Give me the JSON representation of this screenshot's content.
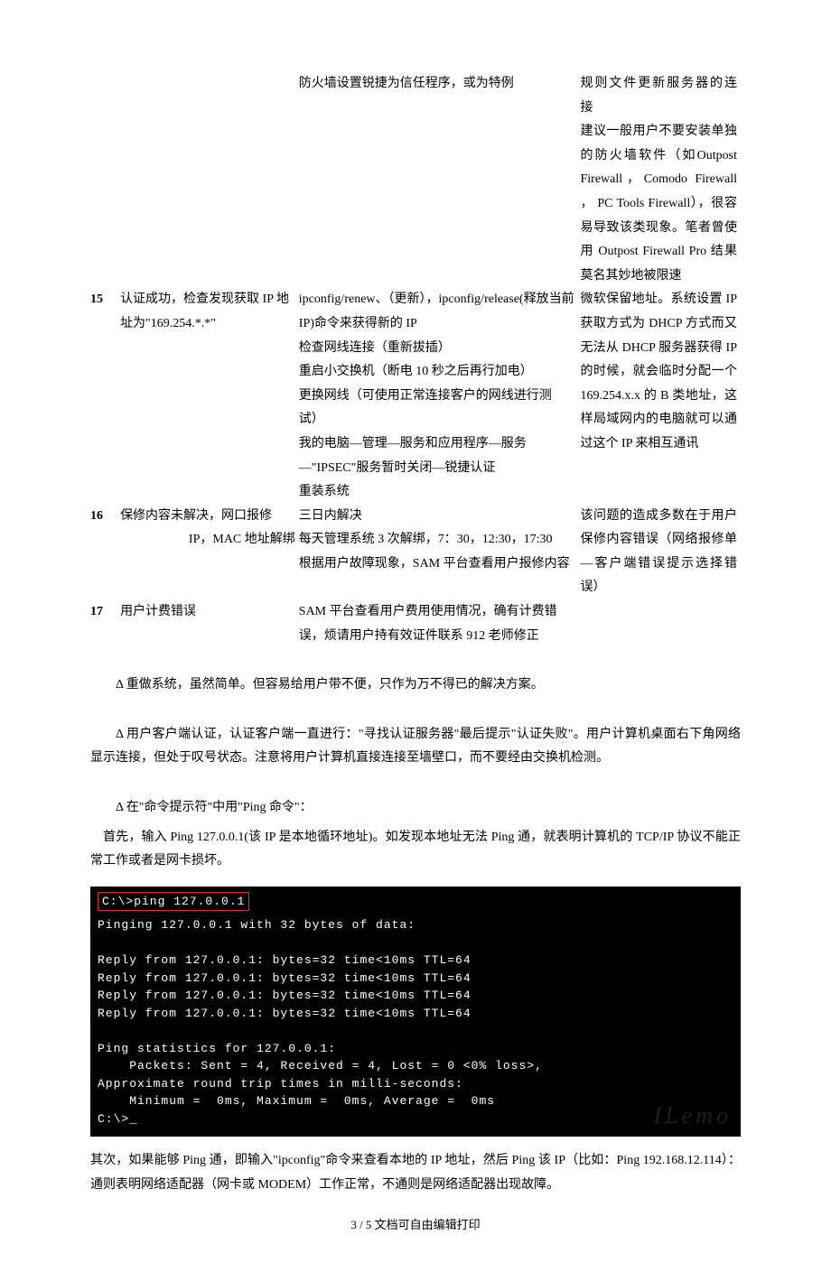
{
  "table": {
    "row14": {
      "sol": "防火墙设置锐捷为信任程序，或为特例",
      "note_l1": "规则文件更新服务器的连",
      "note_l2": "接",
      "note_l3": "建议一般用户不要安装单独的防火墙软件（如Outpost Firewall，Comodo Firewall ， PC Tools Firewall），很容易导致该类现象。笔者曾使用 Outpost Firewall Pro 结果莫名其妙地被限速"
    },
    "row15": {
      "num": "15",
      "issue": "认证成功，检查发现获取 IP 地址为\"169.254.*.*\"",
      "sol": "ipconfig/renew、（更新），ipconfig/release(释放当前 IP)命令来获得新的 IP\n检查网线连接（重新拔插）\n重启小交换机（断电 10 秒之后再行加电）\n更换网线（可使用正常连接客户的网线进行测试）\n我的电脑—管理—服务和应用程序—服务—\"IPSEC\"服务暂时关闭—锐捷认证\n重装系统",
      "note": "微软保留地址。系统设置 IP 获取方式为 DHCP 方式而又无法从 DHCP 服务器获得 IP 的时候，就会临时分配一个 169.254.x.x 的 B 类地址，这样局域网内的电脑就可以通过这个 IP 来相互通讯"
    },
    "row16": {
      "num": "16",
      "issue_l1": "保修内容未解决，网口报修",
      "issue_l2": "IP，MAC 地址解绑",
      "sol": "三日内解决\n每天管理系统 3 次解绑，7：30，12:30，17:30\n根据用户故障现象，SAM 平台查看用户报修内容",
      "note": "该问题的造成多数在于用户保修内容错误（网络报修单—客户端错误提示选择错误）"
    },
    "row17": {
      "num": "17",
      "issue": "用户计费错误",
      "sol": "SAM 平台查看用户费用使用情况，确有计费错误，烦请用户持有效证件联系 912 老师修正",
      "note": ""
    }
  },
  "notes": {
    "n1": "Δ 重做系统，虽然简单。但容易给用户带不便，只作为万不得已的解决方案。",
    "n2": "Δ 用户客户端认证，认证客户端一直进行：\"寻找认证服务器\"最后提示\"认证失败\"。用户计算机桌面右下角网络显示连接，但处于叹号状态。注意将用户计算机直接连接至墙壁口，而不要经由交换机检测。",
    "n3_title": "Δ 在\"命令提示符\"中用\"Ping 命令\"：",
    "n3_body": "首先，输入 Ping 127.0.0.1(该 IP 是本地循环地址)。如发现本地址无法 Ping 通，就表明计算机的 TCP/IP 协议不能正常工作或者是网卡损坏。",
    "n4": "其次，如果能够 Ping 通，即输入\"ipconfig\"命令来查看本地的 IP 地址，然后 Ping 该 IP（比如：Ping 192.168.12.114）：通则表明网络适配器（网卡或 MODEM）工作正常，不通则是网络适配器出现故障。"
  },
  "terminal": {
    "cmd": "C:\\>ping 127.0.0.1",
    "l1": "Pinging 127.0.0.1 with 32 bytes of data:",
    "r1": "Reply from 127.0.0.1: bytes=32 time<10ms TTL=64",
    "r2": "Reply from 127.0.0.1: bytes=32 time<10ms TTL=64",
    "r3": "Reply from 127.0.0.1: bytes=32 time<10ms TTL=64",
    "r4": "Reply from 127.0.0.1: bytes=32 time<10ms TTL=64",
    "s1": "Ping statistics for 127.0.0.1:",
    "s2": "    Packets: Sent = 4, Received = 4, Lost = 0 <0% loss>,",
    "s3": "Approximate round trip times in milli-seconds:",
    "s4": "    Minimum =  0ms, Maximum =  0ms, Average =  0ms",
    "prompt": "C:\\>_"
  },
  "footer": "3 / 5 文档可自由编辑打印"
}
